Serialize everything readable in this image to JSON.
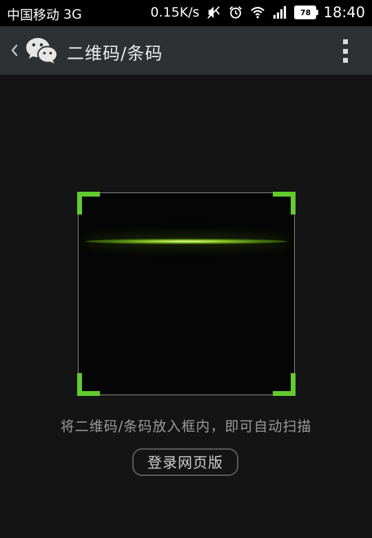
{
  "status_bar": {
    "carrier": "中国移动",
    "network": "3G",
    "speed": "0.15K/s",
    "battery_level": "78",
    "time": "18:40",
    "icons": [
      "silent-icon",
      "alarm-icon",
      "wifi-icon",
      "signal-icon",
      "battery-icon"
    ]
  },
  "action_bar": {
    "back_icon": "chevron-left-icon",
    "app_icon": "wechat-logo-icon",
    "title": "二维码/条码",
    "menu_icon": "overflow-menu-icon"
  },
  "scanner": {
    "accent_color": "#62cc2e",
    "hint": "将二维码/条码放入框内，即可自动扫描",
    "button_label": "登录网页版"
  }
}
